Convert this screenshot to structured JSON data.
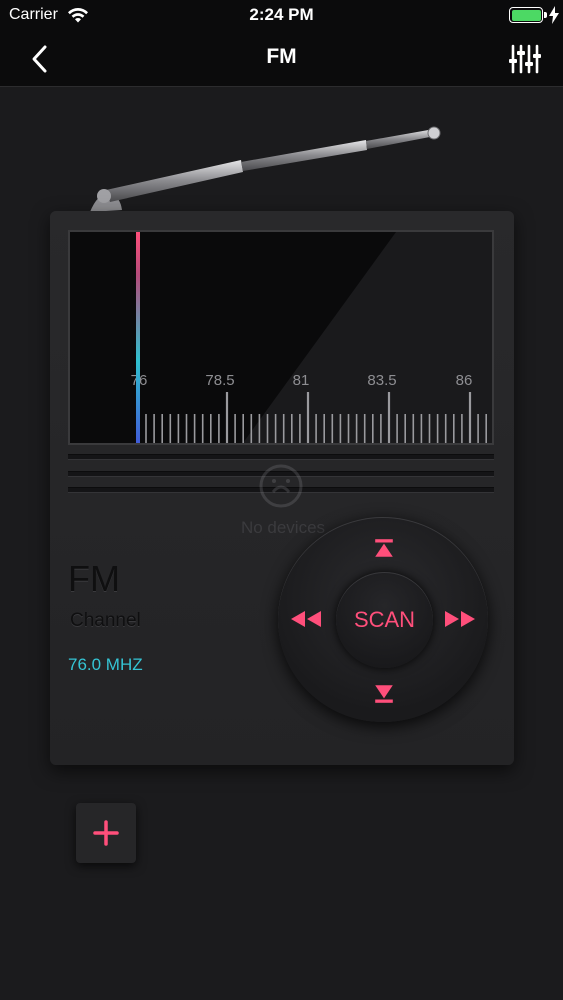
{
  "status_bar": {
    "carrier": "Carrier",
    "time": "2:24 PM",
    "battery_level": 1.0
  },
  "nav": {
    "title": "FM",
    "back_icon": "chevron-left-icon",
    "settings_icon": "equalizer-sliders-icon"
  },
  "dial": {
    "tick_labels": [
      "76",
      "78.5",
      "81",
      "83.5",
      "86"
    ],
    "needle_value": "76"
  },
  "device_notice": {
    "text": "No devices"
  },
  "station": {
    "band": "FM",
    "channel_label": "Channel",
    "frequency": "76.0 MHZ"
  },
  "controls": {
    "scan_label": "SCAN"
  },
  "add_button": {
    "icon": "plus-icon"
  },
  "colors": {
    "accent": "#ff4f7b",
    "frequency_text": "#35c4d4",
    "battery": "#4cd964"
  }
}
